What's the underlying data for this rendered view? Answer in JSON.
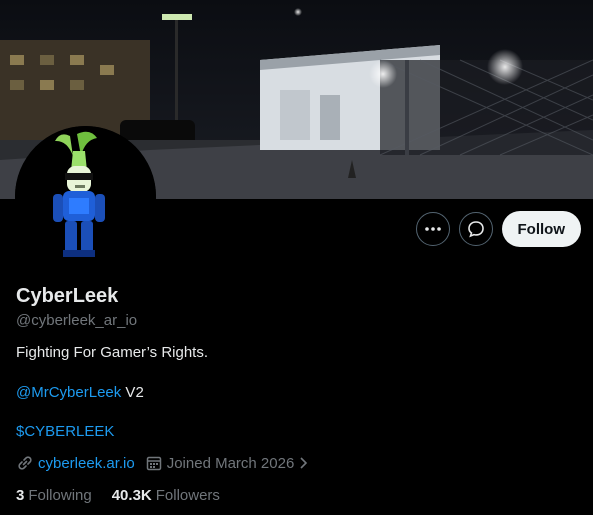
{
  "profile": {
    "name": "CyberLeek",
    "handle": "@cyberleek_ar_io",
    "bio_line1": "Fighting For Gamer’s Rights.",
    "bio_mention": "@MrCyberLeek",
    "bio_mention_suffix": " V2",
    "bio_cashtag": "$CYBERLEEK",
    "website": "cyberleek.ar.io",
    "joined": "Joined March 2026",
    "following_count": "3",
    "following_label": "Following",
    "followers_count": "40.3K",
    "followers_label": "Followers"
  },
  "actions": {
    "follow_label": "Follow"
  },
  "icons": {
    "more": "more-icon",
    "message": "message-icon",
    "link": "link-icon",
    "calendar": "calendar-icon",
    "chevron": "chevron-right-icon"
  },
  "colors": {
    "background": "#000000",
    "text": "#e7e9ea",
    "muted": "#71767b",
    "link": "#1d9bf0",
    "follow_bg": "#eff3f4"
  }
}
